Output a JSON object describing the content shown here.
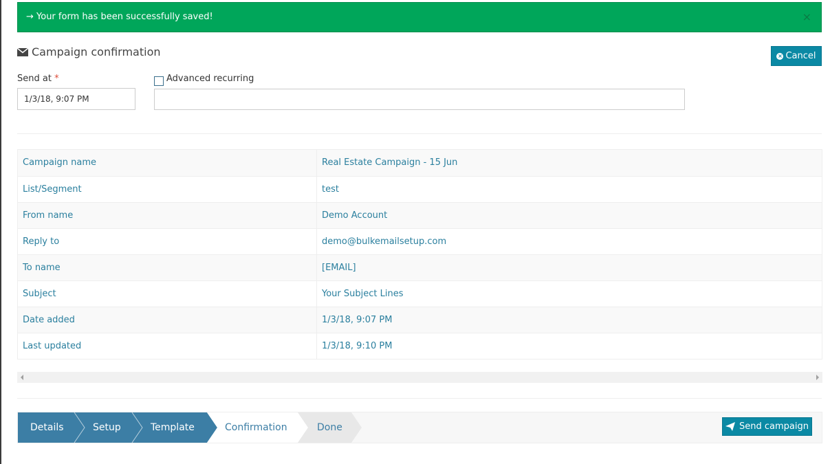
{
  "alert": {
    "message": "→ Your form has been successfully saved!",
    "close_glyph": "×"
  },
  "page": {
    "title": "Campaign confirmation",
    "cancel_label": "Cancel"
  },
  "form": {
    "send_at_label": "Send at",
    "required_mark": "*",
    "send_at_value": "1/3/18, 9:07 PM",
    "advanced_recurring_label": "Advanced recurring",
    "advanced_recurring_checked": false,
    "advanced_recurring_value": ""
  },
  "details": [
    {
      "label": "Campaign name",
      "value": "Real Estate Campaign - 15 Jun"
    },
    {
      "label": "List/Segment",
      "value": "test"
    },
    {
      "label": "From name",
      "value": "Demo Account"
    },
    {
      "label": "Reply to",
      "value": "demo@bulkemailsetup.com"
    },
    {
      "label": "To name",
      "value": "[EMAIL]"
    },
    {
      "label": "Subject",
      "value": "Your Subject Lines"
    },
    {
      "label": "Date added",
      "value": "1/3/18, 9:07 PM"
    },
    {
      "label": "Last updated",
      "value": "1/3/18, 9:10 PM"
    }
  ],
  "wizard": {
    "steps": [
      {
        "label": "Details",
        "state": "done"
      },
      {
        "label": "Setup",
        "state": "done"
      },
      {
        "label": "Template",
        "state": "done"
      },
      {
        "label": "Confirmation",
        "state": "current"
      },
      {
        "label": "Done",
        "state": "todo"
      }
    ],
    "send_label": "Send campaign"
  },
  "colors": {
    "success": "#00a65a",
    "primary": "#0b89a4",
    "step_done": "#3c7ea5",
    "step_todo": "#e8e8e8",
    "link": "#2a7f9e"
  },
  "icons": {
    "title": "envelope-icon",
    "cancel": "times-circle-icon",
    "send": "paper-plane-icon"
  }
}
